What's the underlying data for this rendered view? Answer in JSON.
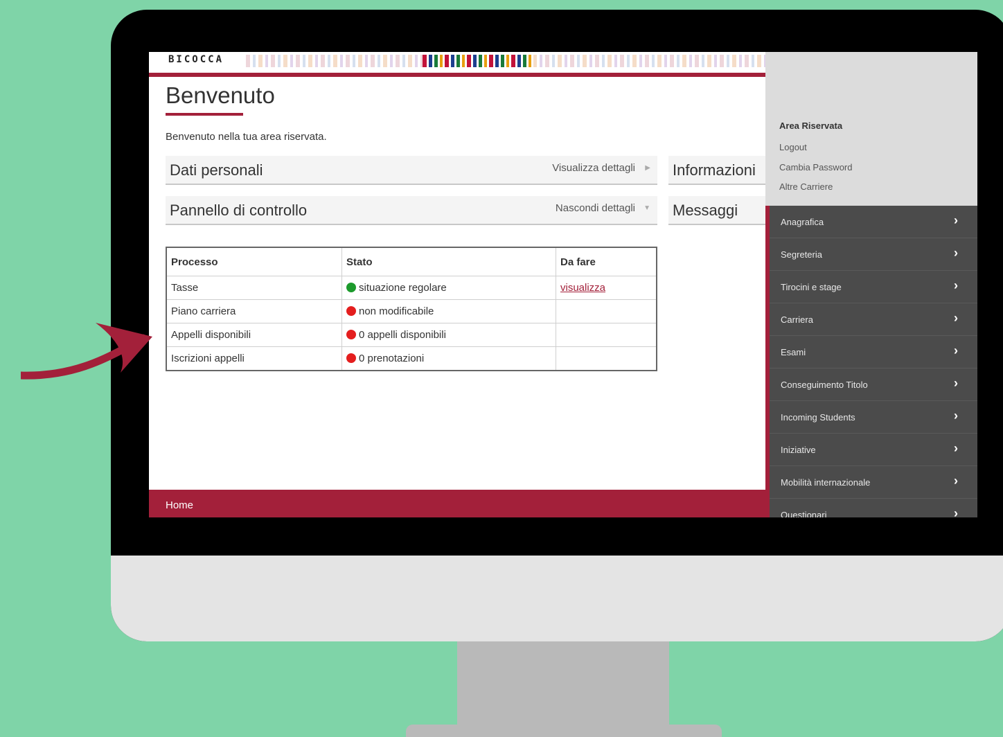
{
  "header": {
    "brand": "BICOCCA"
  },
  "page": {
    "title": "Benvenuto",
    "welcome": "Benvenuto nella tua area riservata."
  },
  "sections": {
    "dati_personali": {
      "title": "Dati personali",
      "action": "Visualizza dettagli"
    },
    "pannello": {
      "title": "Pannello di controllo",
      "action": "Nascondi dettagli"
    }
  },
  "side_sections": {
    "informazioni": "Informazioni",
    "messaggi": "Messaggi"
  },
  "table": {
    "headers": [
      "Processo",
      "Stato",
      "Da fare"
    ],
    "rows": [
      {
        "process": "Tasse",
        "status": "situazione regolare",
        "status_color": "#1c9a2c",
        "todo": "visualizza"
      },
      {
        "process": "Piano carriera",
        "status": "non modificabile",
        "status_color": "#e41e1e",
        "todo": ""
      },
      {
        "process": "Appelli disponibili",
        "status": "0 appelli disponibili",
        "status_color": "#e41e1e",
        "todo": ""
      },
      {
        "process": "Iscrizioni appelli",
        "status": "0 prenotazioni",
        "status_color": "#e41e1e",
        "todo": ""
      }
    ]
  },
  "footer": {
    "home": "Home"
  },
  "sidebar": {
    "area_title": "Area Riservata",
    "links": [
      "Logout",
      "Cambia Password",
      "Altre Carriere"
    ],
    "nav": [
      "Anagrafica",
      "Segreteria",
      "Tirocini e stage",
      "Carriera",
      "Esami",
      "Conseguimento Titolo",
      "Incoming Students",
      "Iniziative",
      "Mobilità internazionale",
      "Questionari"
    ]
  },
  "colors": {
    "brand": "#a3203a",
    "background": "#7fd4a8",
    "sidebar": "#4b4b4b"
  },
  "icons": {
    "section_expand": "caret-right-icon",
    "section_collapse": "caret-down-icon",
    "nav": "chevron-right-icon",
    "pointer": "arrow-icon"
  }
}
